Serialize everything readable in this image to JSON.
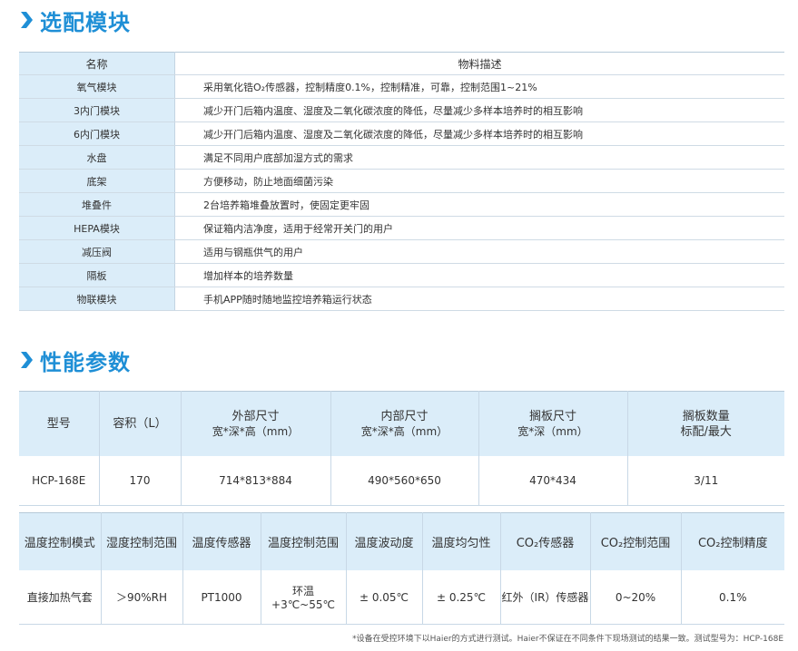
{
  "section1": {
    "title": "选配模块",
    "headers": [
      "名称",
      "物料描述"
    ],
    "rows": [
      {
        "name": "氧气模块",
        "desc": "采用氧化锆O₂传感器，控制精度0.1%，控制精准，可靠，控制范围1~21%"
      },
      {
        "name": "3内门模块",
        "desc": "减少开门后箱内温度、湿度及二氧化碳浓度的降低，尽量减少多样本培养时的相互影响"
      },
      {
        "name": "6内门模块",
        "desc": "减少开门后箱内温度、湿度及二氧化碳浓度的降低，尽量减少多样本培养时的相互影响"
      },
      {
        "name": "水盘",
        "desc": "满足不同用户底部加湿方式的需求"
      },
      {
        "name": "底架",
        "desc": "方便移动，防止地面细菌污染"
      },
      {
        "name": "堆叠件",
        "desc": "2台培养箱堆叠放置时，使固定更牢固"
      },
      {
        "name": "HEPA模块",
        "desc": "保证箱内洁净度，适用于经常开关门的用户"
      },
      {
        "name": "减压阀",
        "desc": "适用与钢瓶供气的用户"
      },
      {
        "name": "隔板",
        "desc": "增加样本的培养数量"
      },
      {
        "name": "物联模块",
        "desc": "手机APP随时随地监控培养箱运行状态"
      }
    ]
  },
  "section2": {
    "title": "性能参数",
    "table_a": {
      "headers": [
        {
          "l1": "型号",
          "l2": ""
        },
        {
          "l1": "容积（L）",
          "l2": ""
        },
        {
          "l1": "外部尺寸",
          "l2": "宽*深*高（mm）"
        },
        {
          "l1": "内部尺寸",
          "l2": "宽*深*高（mm）"
        },
        {
          "l1": "搁板尺寸",
          "l2": "宽*深（mm）"
        },
        {
          "l1": "搁板数量",
          "l2": "标配/最大"
        }
      ],
      "row": [
        "HCP-168E",
        "170",
        "714*813*884",
        "490*560*650",
        "470*434",
        "3/11"
      ]
    },
    "table_b": {
      "headers": [
        "温度控制模式",
        "湿度控制范围",
        "温度传感器",
        "温度控制范围",
        "温度波动度",
        "温度均匀性",
        "CO₂传感器",
        "CO₂控制范围",
        "CO₂控制精度"
      ],
      "row": [
        "直接加热气套",
        "＞90%RH",
        "PT1000",
        "环温+3℃~55℃",
        "± 0.05℃",
        "± 0.25℃",
        "红外（IR）传感器",
        "0~20%",
        "0.1%"
      ]
    },
    "footnote": "*设备在受控环境下以Haier的方式进行测试。Haier不保证在不同条件下现场测试的结果一致。测试型号为：HCP-168E"
  },
  "colors": {
    "accent": "#1f8fd6",
    "header_bg": "#dbedf9",
    "border": "#c8d8e6"
  },
  "icons": [
    "chevron-right-icon"
  ]
}
